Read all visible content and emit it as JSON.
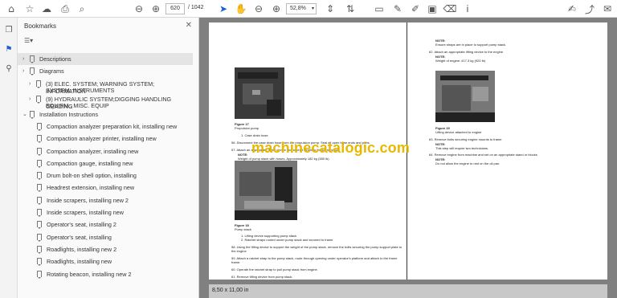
{
  "toolbar": {
    "page_current": "620",
    "page_total": "/ 1042",
    "zoom": "52,8%"
  },
  "bookmarks": {
    "title": "Bookmarks",
    "items": [
      {
        "label": "Descriptions",
        "level": 0,
        "arrow": "›",
        "selected": true
      },
      {
        "label": "Diagrams",
        "level": 0,
        "arrow": "›",
        "selected": false
      },
      {
        "label": "(3) ELEC. SYSTEM; WARNING SYSTEM; INFORMATION",
        "label2": "SYSTEM; INSTRUMENTS",
        "level": 1,
        "arrow": "›",
        "selected": false
      },
      {
        "label": "(9) HYDRAULIC SYSTEM;DIGGING HANDLING GRADING",
        "label2": "EQUIPM.; MISC. EQUIP",
        "level": 1,
        "arrow": "›",
        "selected": false
      },
      {
        "label": "Installation Instructions",
        "level": 0,
        "arrow": "⌄",
        "selected": false
      },
      {
        "label": "Compaction analyzer preparation kit, installing new",
        "level": 1,
        "arrow": "",
        "selected": false
      },
      {
        "label": "Compaction analyzer printer, installing new",
        "level": 1,
        "arrow": "",
        "selected": false
      },
      {
        "label": "Compaction analyzer, installing new",
        "level": 1,
        "arrow": "",
        "selected": false
      },
      {
        "label": "Compaction gauge, installing new",
        "level": 1,
        "arrow": "",
        "selected": false
      },
      {
        "label": "Drum bolt-on shell option, installing",
        "level": 1,
        "arrow": "",
        "selected": false
      },
      {
        "label": "Headrest extension, installing new",
        "level": 1,
        "arrow": "",
        "selected": false
      },
      {
        "label": "Inside scrapers, installing new 2",
        "level": 1,
        "arrow": "",
        "selected": false
      },
      {
        "label": "Inside scrapers, installing new",
        "level": 1,
        "arrow": "",
        "selected": false
      },
      {
        "label": "Operator's seat, installing 2",
        "level": 1,
        "arrow": "",
        "selected": false
      },
      {
        "label": "Operator's seat, installing",
        "level": 1,
        "arrow": "",
        "selected": false
      },
      {
        "label": "Roadlights, installing new 2",
        "level": 1,
        "arrow": "",
        "selected": false
      },
      {
        "label": "Roadlights, installing new",
        "level": 1,
        "arrow": "",
        "selected": false
      },
      {
        "label": "Rotating beacon, installing new 2",
        "level": 1,
        "arrow": "",
        "selected": false
      }
    ]
  },
  "document": {
    "left": {
      "fig17_title": "Figure 17",
      "fig17_sub": "Propulsion pump",
      "fig17_item": "1.     Case drain hose",
      "s56": "56.    Disconnect the case drain hose from the propulsion pump. Seal all open hose ends and ports.",
      "s57": "57.    Attach an appropriate lifting device and ratchet straps to the pump stack.",
      "s57_note": "NOTE:",
      "s57_weight": "Weight of pump stack with hoses: Approximately 182 kg (380 lb)",
      "fig18_title": "Figure 18",
      "fig18_sub": "Pump stack",
      "fig18_item1": "1.     Lifting device supporting pump stack",
      "fig18_item2": "2.     Ratchet straps routed under pump stack and secured to frame",
      "s58": "58.    Using the lifting device to support the weight of the pump stack, remove the bolts securing the pump support plate to",
      "s58b": "         the engine",
      "s59": "59.    Attach a ratchet strap to the pump stack, route through opening under operator's platform and attach to the frame",
      "s59b": "         frame.",
      "s60": "60.    Operate the ratchet strap to pull pump stack from engine.",
      "s61": "61.    Remove lifting device from pump stack."
    },
    "right": {
      "note": "NOTE:",
      "note_txt": "Ensure straps are in place to support pump stack.",
      "s62": "62.    Attach an appropriate lifting device to the engine",
      "s62_note": "NOTE:",
      "s62_weight": "Weight of engine: 417.3 kg (920 lb)",
      "fig19_title": "Figure 19",
      "fig19_sub": "Lifting device attached to engine",
      "s63": "63.    Remove bolts securing engine mounts to frame",
      "s63_note": "NOTE:",
      "s63_txt": "This step will require two technicians.",
      "s64": "64.    Remove engine from machine and set on an appropriate stand or blocks",
      "s64_note": "NOTE:",
      "s64_txt": "Do not allow the engine to rest on the oil pan."
    },
    "watermark": "machinecatalogic.com",
    "page_size": "8,50 x 11,00 in"
  }
}
